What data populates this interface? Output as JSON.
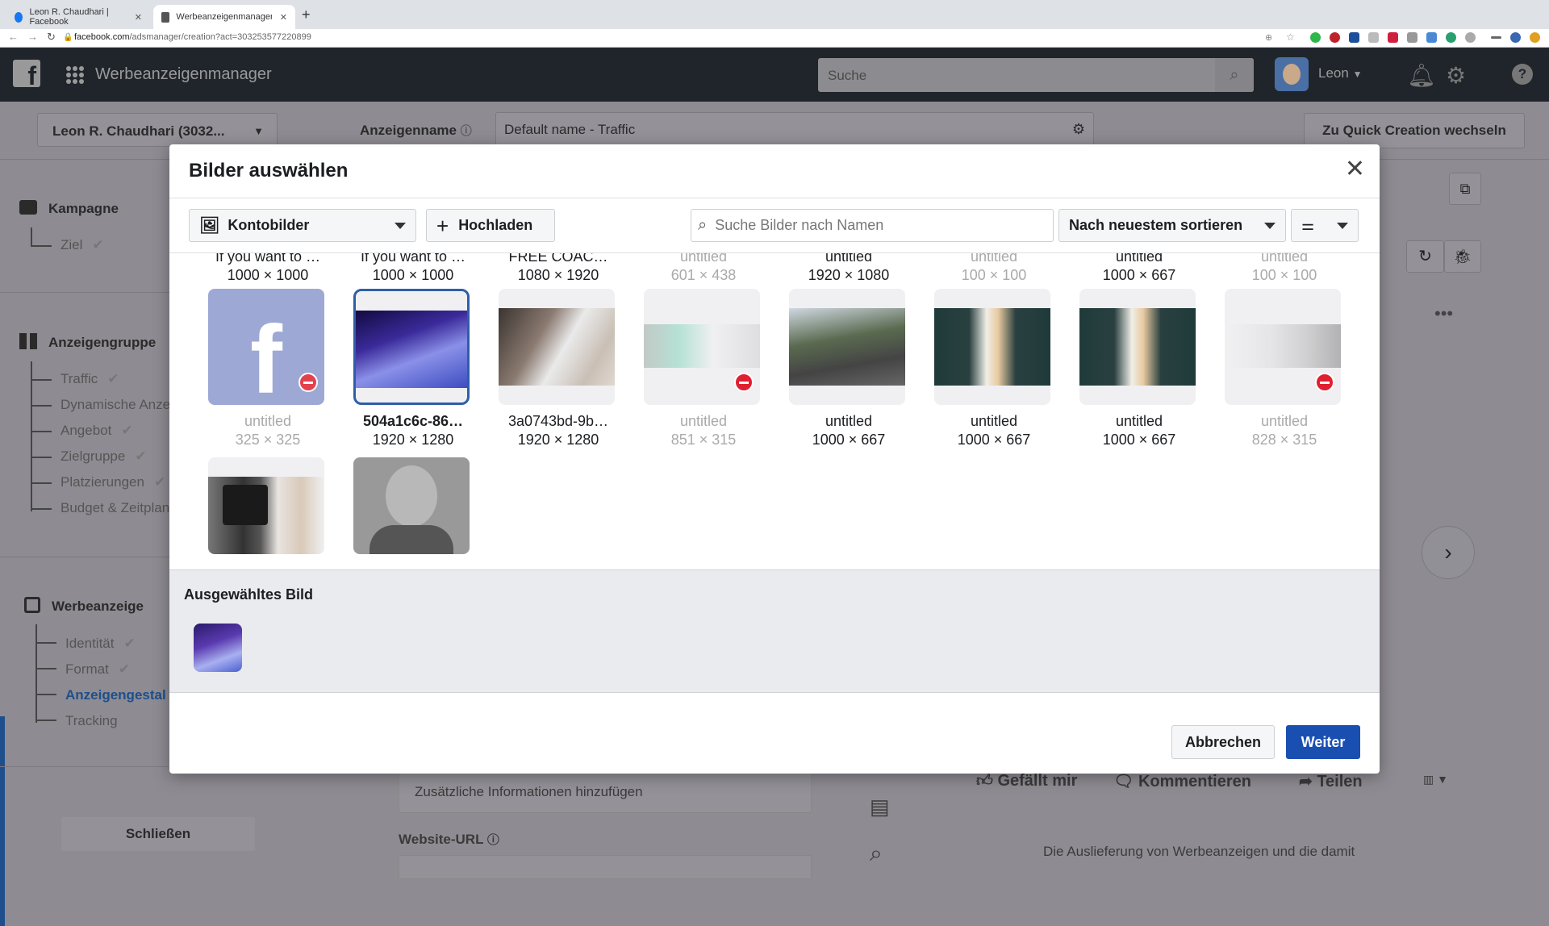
{
  "browser": {
    "tabs": [
      {
        "title": "Leon R. Chaudhari | Facebook",
        "active": false
      },
      {
        "title": "Werbeanzeigenmanager - Cre",
        "active": true
      }
    ],
    "url_domain": "facebook.com",
    "url_path": "/adsmanager/creation?act=303253577220899"
  },
  "header": {
    "app_title": "Werbeanzeigenmanager",
    "search_placeholder": "Suche",
    "user_name": "Leon"
  },
  "subbar": {
    "account": "Leon R. Chaudhari (3032...",
    "ad_name_label": "Anzeigenname",
    "ad_name_value": "Default name - Traffic",
    "quick_creation": "Zu Quick Creation wechseln"
  },
  "sidebar": {
    "campaign": {
      "label": "Kampagne",
      "items": [
        {
          "label": "Ziel",
          "done": true
        }
      ]
    },
    "adset": {
      "label": "Anzeigengruppe",
      "items": [
        {
          "label": "Traffic",
          "done": true
        },
        {
          "label": "Dynamische Anze",
          "done": false
        },
        {
          "label": "Angebot",
          "done": true
        },
        {
          "label": "Zielgruppe",
          "done": true
        },
        {
          "label": "Platzierungen",
          "done": true
        },
        {
          "label": "Budget & Zeitplan",
          "done": false
        }
      ]
    },
    "ad": {
      "label": "Werbeanzeige",
      "items": [
        {
          "label": "Identität",
          "done": true
        },
        {
          "label": "Format",
          "done": true
        },
        {
          "label": "Anzeigengestal",
          "done": false,
          "active": true
        },
        {
          "label": "Tracking",
          "done": false
        }
      ]
    },
    "close": "Schließen"
  },
  "background": {
    "additional_info": "Zusätzliche Informationen hinzufügen",
    "website_url_label": "Website-URL",
    "like": "Gefällt mir",
    "comment": "Kommentieren",
    "share": "Teilen",
    "delivery_note": "Die Auslieferung von Werbeanzeigen und die damit"
  },
  "modal": {
    "title": "Bilder auswählen",
    "source_dropdown": "Kontobilder",
    "upload": "Hochladen",
    "search_placeholder": "Suche Bilder nach Namen",
    "sort": "Nach neuestem sortieren",
    "row0": [
      {
        "name": "If you want to …",
        "dims": "1000 × 1000",
        "disabled": false
      },
      {
        "name": "If you want to …",
        "dims": "1000 × 1000",
        "disabled": false
      },
      {
        "name": "FREE COAC…",
        "dims": "1080 × 1920",
        "disabled": false
      },
      {
        "name": "untitled",
        "dims": "601 × 438",
        "disabled": true
      },
      {
        "name": "untitled",
        "dims": "1920 × 1080",
        "disabled": false
      },
      {
        "name": "untitled",
        "dims": "100 × 100",
        "disabled": true
      },
      {
        "name": "untitled",
        "dims": "1000 × 667",
        "disabled": false
      },
      {
        "name": "untitled",
        "dims": "100 × 100",
        "disabled": true
      }
    ],
    "row1": [
      {
        "name": "untitled",
        "dims": "325 × 325",
        "disabled": true
      },
      {
        "name": "504a1c6c-86…",
        "dims": "1920 × 1280",
        "selected": true
      },
      {
        "name": "3a0743bd-9b…",
        "dims": "1920 × 1280",
        "disabled": false
      },
      {
        "name": "untitled",
        "dims": "851 × 315",
        "disabled": true
      },
      {
        "name": "untitled",
        "dims": "1000 × 667",
        "disabled": false
      },
      {
        "name": "untitled",
        "dims": "1000 × 667",
        "disabled": false
      },
      {
        "name": "untitled",
        "dims": "1000 × 667",
        "disabled": false
      },
      {
        "name": "untitled",
        "dims": "828 × 315",
        "disabled": true
      }
    ],
    "selected_title": "Ausgewähltes Bild",
    "cancel": "Abbrechen",
    "next": "Weiter"
  },
  "colors": {
    "primary": "#1a4fb2",
    "selected_border": "#2d5fa8",
    "error": "#e02030"
  }
}
